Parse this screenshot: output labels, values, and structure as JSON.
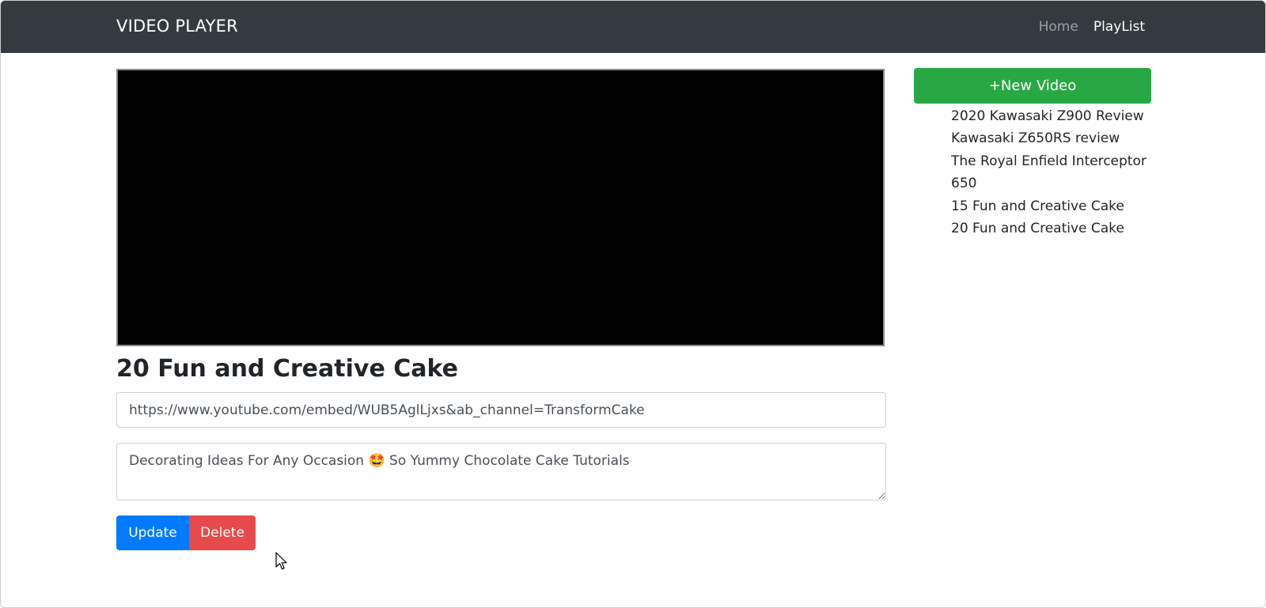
{
  "navbar": {
    "brand": "VIDEO PLAYER",
    "links": [
      {
        "label": "Home",
        "active": false
      },
      {
        "label": "PlayList",
        "active": true
      }
    ]
  },
  "player": {
    "title": "20 Fun and Creative Cake",
    "url_value": "https://www.youtube.com/embed/WUB5AglLjxs&ab_channel=TransformCake",
    "description_value": "Decorating Ideas For Any Occasion 🤩 So Yummy Chocolate Cake Tutorials"
  },
  "actions": {
    "update_label": "Update",
    "delete_label": "Delete"
  },
  "sidebar": {
    "new_video_label": "+New Video",
    "videos": [
      "2020 Kawasaki Z900 Review",
      "Kawasaki Z650RS review",
      "The Royal Enfield Interceptor 650",
      "15 Fun and Creative Cake",
      "20 Fun and Creative Cake"
    ]
  },
  "colors": {
    "navbar": "#343a40",
    "primary": "#007bff",
    "danger": "#e74a4a",
    "success": "#28a745",
    "player_background": "#000000"
  },
  "icons": {
    "cursor": "mouse-pointer-icon"
  }
}
